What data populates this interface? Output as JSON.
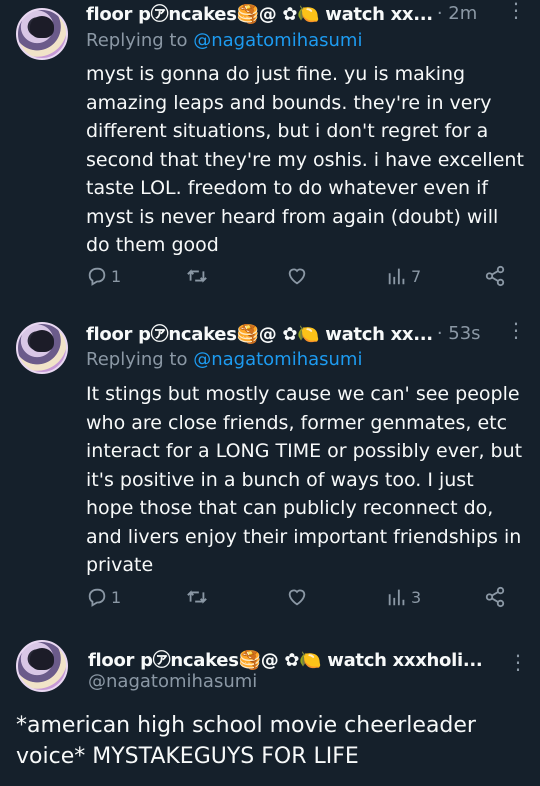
{
  "tweets": [
    {
      "display_name": "floor p㋐ncakes🥞@ ✿🍋 watch xx...",
      "time": "· 2m",
      "replying_prefix": "Replying to ",
      "replying_handle": "@nagatomihasumi",
      "text": "myst is gonna do just fine. yu is making amazing leaps and bounds. they're in very different situations, but i don't regret for a second that they're my oshis. i have excellent taste LOL. freedom to do whatever even if myst is never heard from again (doubt) will do them good",
      "replies": "1",
      "retweets": "",
      "likes": "",
      "views": "7"
    },
    {
      "display_name": "floor p㋐ncakes🥞@ ✿🍋 watch xx...",
      "time": "· 53s",
      "replying_prefix": "Replying to ",
      "replying_handle": "@nagatomihasumi",
      "text": "It stings but mostly cause we can' see people who are close friends, former genmates, etc interact for a LONG TIME or possibly ever, but it's positive in a bunch of ways too. I just hope those that can publicly reconnect do, and livers enjoy their important friendships in private",
      "replies": "1",
      "retweets": "",
      "likes": "",
      "views": "3"
    }
  ],
  "main_tweet": {
    "display_name": "floor p㋐ncakes🥞@ ✿🍋 watch xxxholi...",
    "handle": "@nagatomihasumi",
    "text": "*american high school movie cheerleader voice* MYSTAKEGUYS FOR LIFE"
  },
  "icons": {
    "reply": "reply-icon",
    "retweet": "retweet-icon",
    "like": "heart-icon",
    "views": "views-icon",
    "share": "share-icon",
    "more": "more-dots-icon"
  },
  "colors": {
    "background": "#15202b",
    "text": "#f7f9f9",
    "secondary": "#8b98a5",
    "link": "#1d9bf0"
  }
}
